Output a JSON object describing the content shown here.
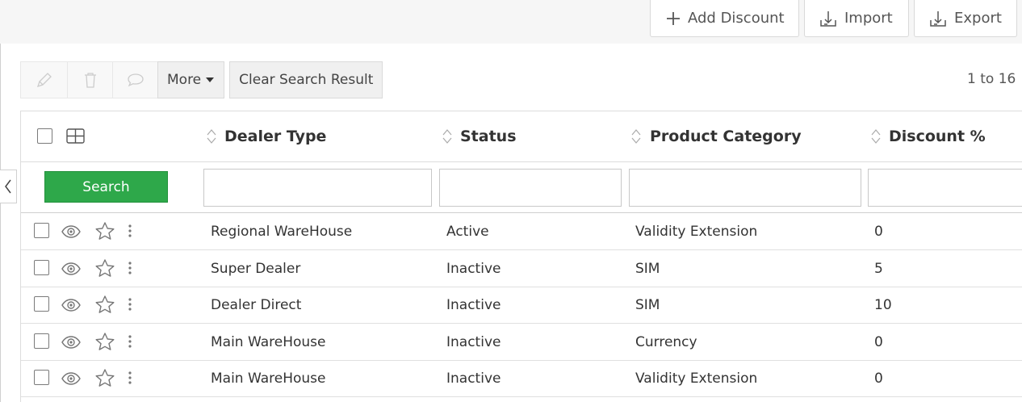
{
  "toolbar_top": {
    "add_label": "Add Discount",
    "import_label": "Import",
    "export_label": "Export"
  },
  "toolbar": {
    "more_label": "More",
    "clear_label": "Clear Search Result",
    "paging_text": "1 to 16"
  },
  "table": {
    "columns": [
      "Dealer Type",
      "Status",
      "Product Category",
      "Discount %"
    ],
    "search_label": "Search",
    "rows": [
      {
        "dealer_type": "Regional WareHouse",
        "status": "Active",
        "product_category": "Validity Extension",
        "discount": "0"
      },
      {
        "dealer_type": "Super Dealer",
        "status": "Inactive",
        "product_category": "SIM",
        "discount": "5"
      },
      {
        "dealer_type": "Dealer Direct",
        "status": "Inactive",
        "product_category": "SIM",
        "discount": "10"
      },
      {
        "dealer_type": "Main WareHouse",
        "status": "Inactive",
        "product_category": "Currency",
        "discount": "0"
      },
      {
        "dealer_type": "Main WareHouse",
        "status": "Inactive",
        "product_category": "Validity Extension",
        "discount": "0"
      }
    ]
  },
  "icons": {
    "add": "plus-icon",
    "import": "import-icon",
    "export": "export-icon",
    "edit": "pencil-icon",
    "delete": "trash-icon",
    "comment": "comment-icon",
    "columns": "grid-icon",
    "view": "eye-icon",
    "favorite": "star-icon",
    "menu": "kebab-icon"
  },
  "colors": {
    "search_button": "#2ea84a",
    "topbar_bg": "#f6f6f6"
  }
}
